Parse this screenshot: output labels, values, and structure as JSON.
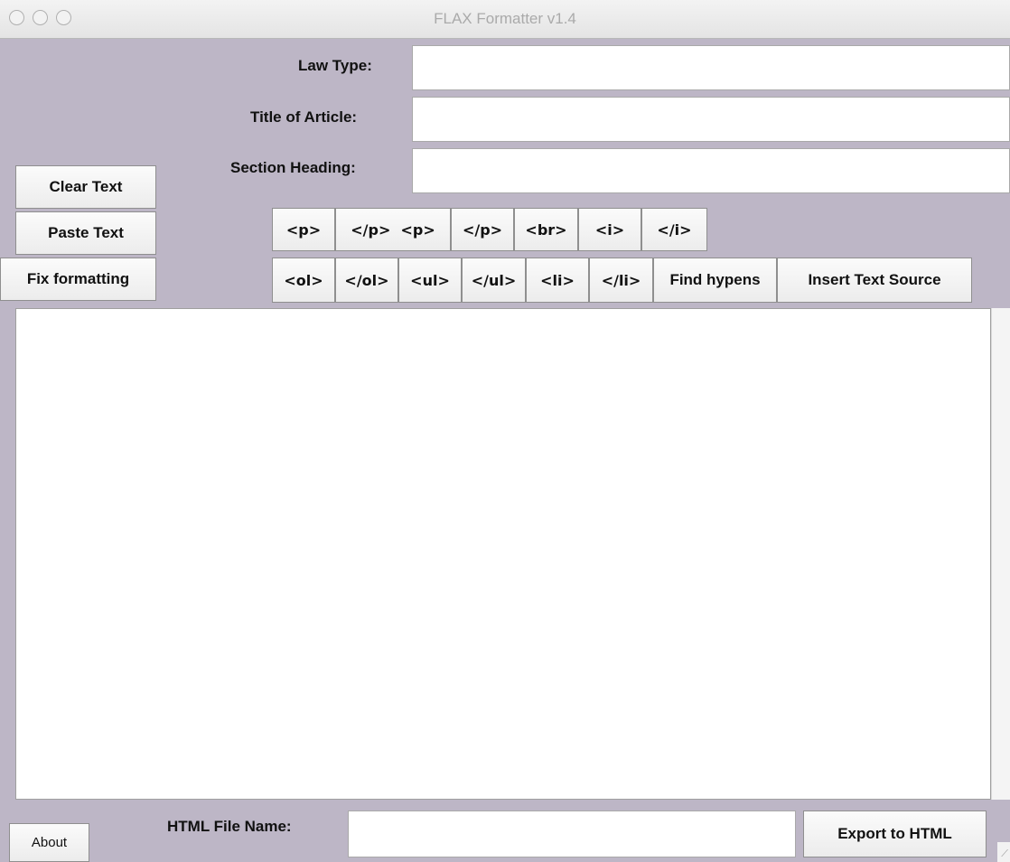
{
  "window": {
    "title": "FLAX Formatter v1.4"
  },
  "fields": {
    "law_type_label": "Law Type:",
    "title_label": "Title of Article:",
    "section_label": "Section Heading:",
    "law_type_value": "",
    "title_value": "",
    "section_value": ""
  },
  "side_buttons": {
    "clear": "Clear Text",
    "paste": "Paste Text",
    "fix": "Fix formatting"
  },
  "tag_row1": [
    "<p>",
    "</p>  <p>",
    "</p>",
    "<br>",
    "<i>",
    "</i>"
  ],
  "tag_row2": [
    "<ol>",
    "</ol>",
    "<ul>",
    "</ul>",
    "<li>",
    "</li>",
    "Find hypens",
    "Insert Text Source"
  ],
  "editor": {
    "content": ""
  },
  "footer": {
    "about": "About",
    "file_label": "HTML File Name:",
    "file_value": "",
    "export": "Export to HTML"
  }
}
